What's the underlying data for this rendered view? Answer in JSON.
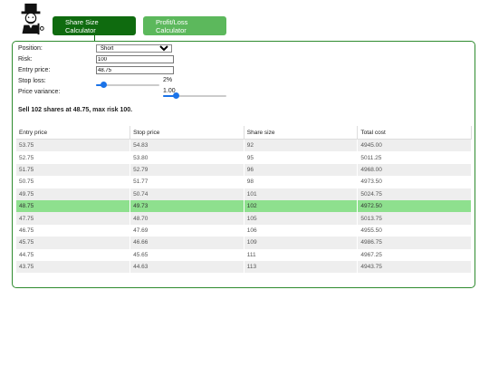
{
  "logo": {
    "icon": "monopoly-man-logo-icon"
  },
  "tabs": [
    {
      "label": "Share Size Calculator",
      "active": true
    },
    {
      "label": "Profit/Loss Calculator",
      "active": false
    }
  ],
  "colors": {
    "active_tab": "#0f6b0f",
    "inactive_tab": "#5cb85c",
    "panel_border": "#2e8b2e",
    "highlight": "#8ee08e",
    "slider": "#1a73e8"
  },
  "form": {
    "position": {
      "label": "Position:",
      "value": "Short",
      "options": [
        "Short"
      ]
    },
    "risk": {
      "label": "Risk:",
      "value": "100"
    },
    "entry_price": {
      "label": "Entry price:",
      "value": "48.75"
    },
    "stop_loss": {
      "label": "Stop loss:",
      "value": "2%",
      "level": 0.12
    },
    "price_variance": {
      "label": "Price variance:",
      "value": "1.00",
      "level": 0.2
    }
  },
  "summary": "Sell 102 shares at 48.75, max risk 100.",
  "table": {
    "headers": [
      "Entry price",
      "Stop price",
      "Share size",
      "Total cost"
    ],
    "rows": [
      [
        "53.75",
        "54.83",
        "92",
        "4945.00"
      ],
      [
        "52.75",
        "53.80",
        "95",
        "5011.25"
      ],
      [
        "51.75",
        "52.79",
        "96",
        "4968.00"
      ],
      [
        "50.75",
        "51.77",
        "98",
        "4973.50"
      ],
      [
        "49.75",
        "50.74",
        "101",
        "5024.75"
      ],
      [
        "48.75",
        "49.73",
        "102",
        "4972.50"
      ],
      [
        "47.75",
        "48.70",
        "105",
        "5013.75"
      ],
      [
        "46.75",
        "47.69",
        "106",
        "4955.50"
      ],
      [
        "45.75",
        "46.66",
        "109",
        "4986.75"
      ],
      [
        "44.75",
        "45.65",
        "111",
        "4967.25"
      ],
      [
        "43.75",
        "44.63",
        "113",
        "4943.75"
      ]
    ],
    "highlighted_row": 5
  }
}
